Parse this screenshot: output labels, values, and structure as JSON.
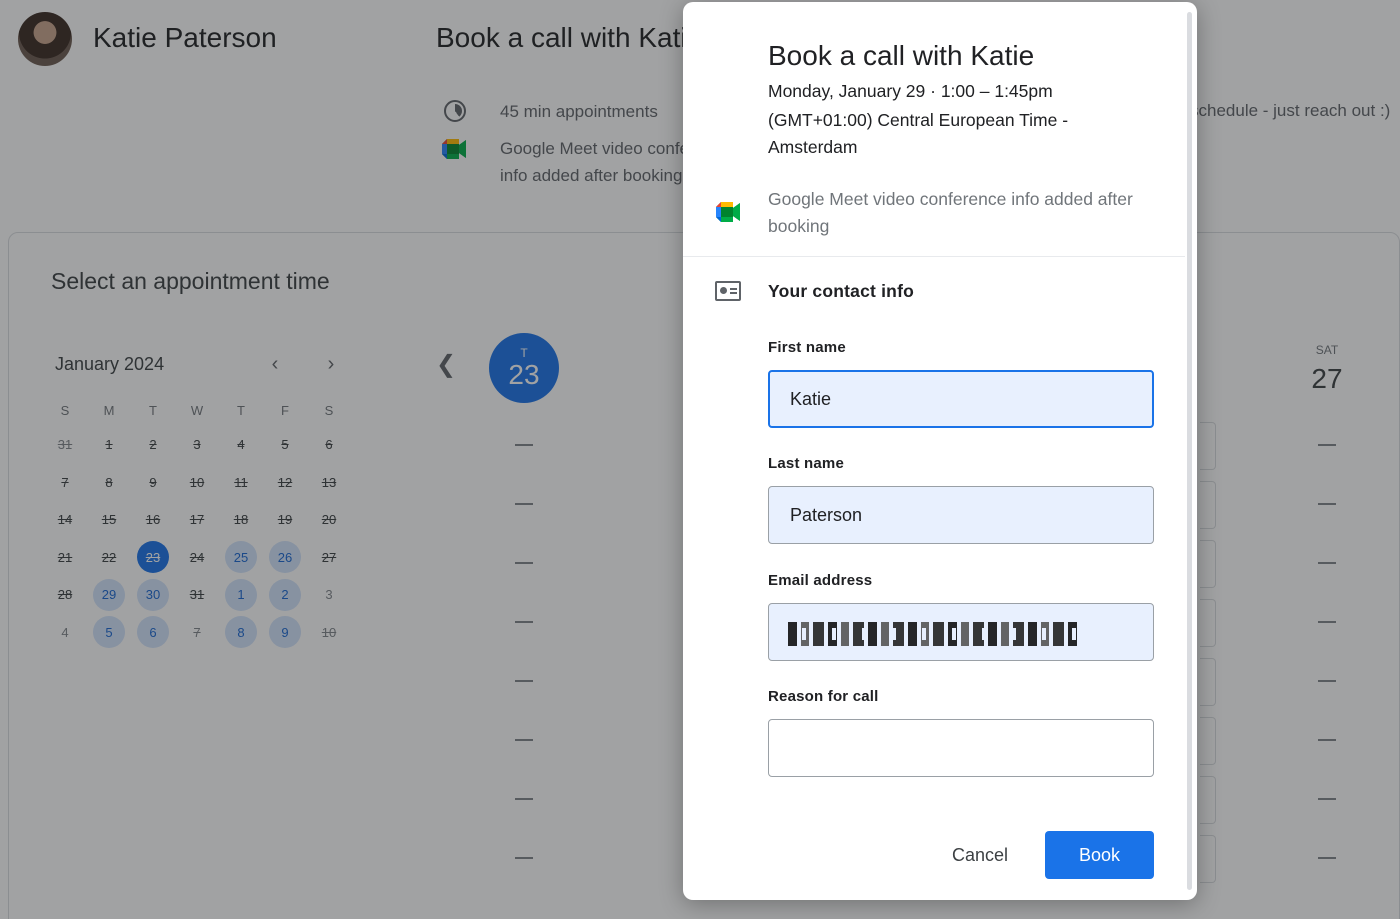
{
  "header": {
    "owner_name": "Katie Paterson",
    "page_title": "Book a call with Katie",
    "duration_text": "45 min appointments",
    "meet_text": "Google Meet video conference info added after booking",
    "availability_note": "schedule - just reach out :)"
  },
  "calendar": {
    "section_title": "Select an appointment time",
    "month_label": "January 2024",
    "weekday_headers": [
      "S",
      "M",
      "T",
      "W",
      "T",
      "F",
      "S"
    ],
    "days": [
      {
        "label": "31",
        "state": "other"
      },
      {
        "label": "1",
        "state": "past"
      },
      {
        "label": "2",
        "state": "past"
      },
      {
        "label": "3",
        "state": "past"
      },
      {
        "label": "4",
        "state": "past"
      },
      {
        "label": "5",
        "state": "past"
      },
      {
        "label": "6",
        "state": "past"
      },
      {
        "label": "7",
        "state": "past"
      },
      {
        "label": "8",
        "state": "past"
      },
      {
        "label": "9",
        "state": "past"
      },
      {
        "label": "10",
        "state": "past"
      },
      {
        "label": "11",
        "state": "past"
      },
      {
        "label": "12",
        "state": "past"
      },
      {
        "label": "13",
        "state": "past"
      },
      {
        "label": "14",
        "state": "past"
      },
      {
        "label": "15",
        "state": "past"
      },
      {
        "label": "16",
        "state": "past"
      },
      {
        "label": "17",
        "state": "past"
      },
      {
        "label": "18",
        "state": "past"
      },
      {
        "label": "19",
        "state": "past"
      },
      {
        "label": "20",
        "state": "past"
      },
      {
        "label": "21",
        "state": "past"
      },
      {
        "label": "22",
        "state": "past"
      },
      {
        "label": "23",
        "state": "selected"
      },
      {
        "label": "24",
        "state": "past"
      },
      {
        "label": "25",
        "state": "avail"
      },
      {
        "label": "26",
        "state": "avail"
      },
      {
        "label": "27",
        "state": "past"
      },
      {
        "label": "28",
        "state": "past"
      },
      {
        "label": "29",
        "state": "avail"
      },
      {
        "label": "30",
        "state": "avail"
      },
      {
        "label": "31",
        "state": "past"
      },
      {
        "label": "1",
        "state": "avail"
      },
      {
        "label": "2",
        "state": "avail"
      },
      {
        "label": "3",
        "state": "next"
      },
      {
        "label": "4",
        "state": "next"
      },
      {
        "label": "5",
        "state": "avail"
      },
      {
        "label": "6",
        "state": "avail"
      },
      {
        "label": "7",
        "state": "other"
      },
      {
        "label": "8",
        "state": "avail"
      },
      {
        "label": "9",
        "state": "avail"
      },
      {
        "label": "10",
        "state": "other"
      }
    ],
    "prev_icon": "chevron-left-icon",
    "next_icon": "chevron-right-icon"
  },
  "week_view": {
    "selected_day": {
      "dow": "T",
      "num": "23"
    },
    "last_day": {
      "dow": "SAT",
      "num": "27"
    }
  },
  "dialog": {
    "title": "Book a call with Katie",
    "date_time": "Monday, January 29 · 1:00 – 1:45pm",
    "timezone": "(GMT+01:00) Central European Time - Amsterdam",
    "meet_text": "Google Meet video conference info added after booking",
    "contact_title": "Your contact info",
    "fields": {
      "first_name": {
        "label": "First name",
        "value": "Katie"
      },
      "last_name": {
        "label": "Last name",
        "value": "Paterson"
      },
      "email": {
        "label": "Email address",
        "value": ""
      },
      "reason": {
        "label": "Reason for call",
        "value": ""
      }
    },
    "cancel_label": "Cancel",
    "book_label": "Book"
  },
  "colors": {
    "accent": "#1a73e8",
    "field_fill": "#e8f0fe",
    "available_day": "#d2e3fc"
  }
}
